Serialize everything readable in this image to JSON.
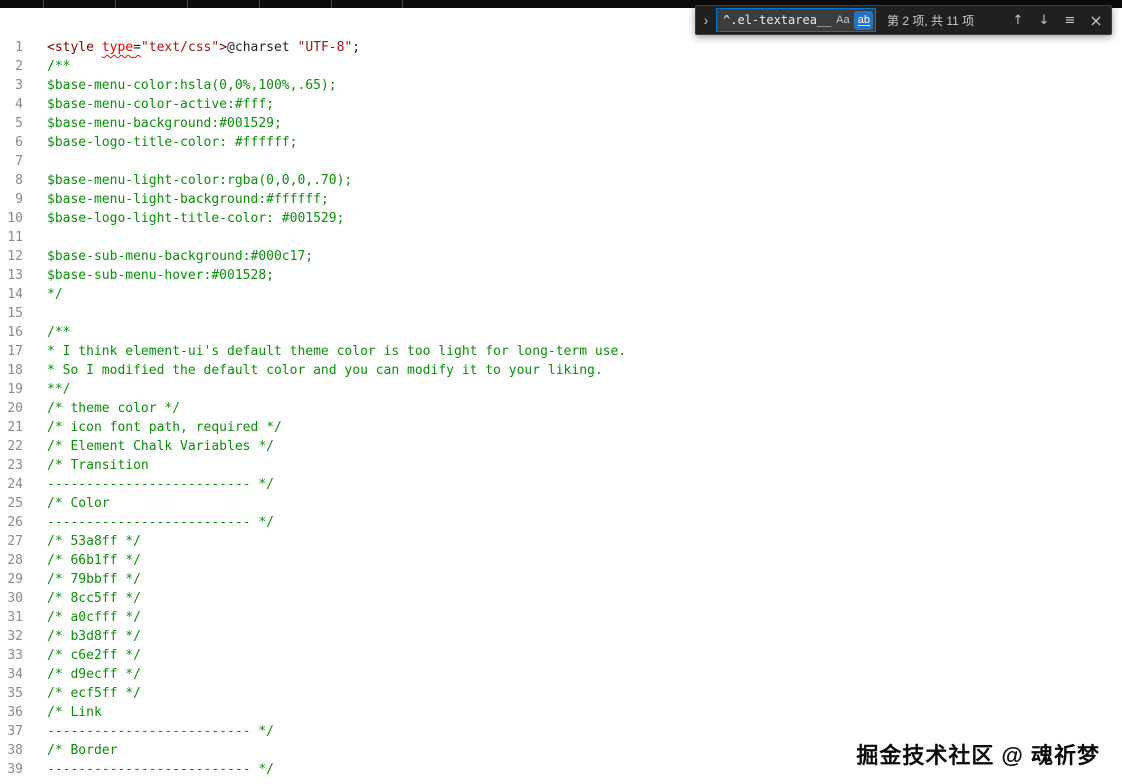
{
  "find_widget": {
    "chevron_icon": "›",
    "query_before_cursor": "^.el-",
    "query_after_cursor": "textarea__",
    "match_case_label": "Aa",
    "whole_word_label": "ab",
    "regex_label": ".*",
    "results_text": "第 2 项, 共 11 项",
    "prev_icon": "↑",
    "next_icon": "↓",
    "selection_icon": "≡",
    "close_icon": "×",
    "accent_color": "#0078d4",
    "toggle_active_bg": "#2473bf"
  },
  "editor": {
    "lines": [
      {
        "kind": "code",
        "tokens": [
          {
            "text": "<style ",
            "class": "tag"
          },
          {
            "text": "type",
            "class": "attr sq"
          },
          {
            "text": "=",
            "class": "plain sq"
          },
          {
            "text": "\"text/css\"",
            "class": "string"
          },
          {
            "text": ">",
            "class": "tag"
          },
          {
            "text": "@charset ",
            "class": "plain"
          },
          {
            "text": "\"UTF-8\"",
            "class": "string"
          },
          {
            "text": ";",
            "class": "plain"
          }
        ]
      },
      {
        "kind": "comment",
        "text": "/**"
      },
      {
        "kind": "comment",
        "text": "$base-menu-color:hsla(0,0%,100%,.65);"
      },
      {
        "kind": "comment",
        "text": "$base-menu-color-active:#fff;"
      },
      {
        "kind": "comment",
        "text": "$base-menu-background:#001529;"
      },
      {
        "kind": "comment",
        "text": "$base-logo-title-color: #ffffff;"
      },
      {
        "kind": "blank",
        "text": ""
      },
      {
        "kind": "comment",
        "text": "$base-menu-light-color:rgba(0,0,0,.70);"
      },
      {
        "kind": "comment",
        "text": "$base-menu-light-background:#ffffff;"
      },
      {
        "kind": "comment",
        "text": "$base-logo-light-title-color: #001529;"
      },
      {
        "kind": "blank",
        "text": ""
      },
      {
        "kind": "comment",
        "text": "$base-sub-menu-background:#000c17;"
      },
      {
        "kind": "comment",
        "text": "$base-sub-menu-hover:#001528;"
      },
      {
        "kind": "comment",
        "text": "*/"
      },
      {
        "kind": "blank",
        "text": ""
      },
      {
        "kind": "comment",
        "text": "/**"
      },
      {
        "kind": "comment",
        "text": "* I think element-ui's default theme color is too light for long-term use."
      },
      {
        "kind": "comment",
        "text": "* So I modified the default color and you can modify it to your liking."
      },
      {
        "kind": "comment",
        "text": "**/"
      },
      {
        "kind": "comment",
        "text": "/* theme color */"
      },
      {
        "kind": "comment",
        "text": "/* icon font path, required */"
      },
      {
        "kind": "comment",
        "text": "/* Element Chalk Variables */"
      },
      {
        "kind": "comment",
        "text": "/* Transition"
      },
      {
        "kind": "comment",
        "text": "-------------------------- */"
      },
      {
        "kind": "comment",
        "text": "/* Color"
      },
      {
        "kind": "comment",
        "text": "-------------------------- */"
      },
      {
        "kind": "comment",
        "text": "/* 53a8ff */"
      },
      {
        "kind": "comment",
        "text": "/* 66b1ff */"
      },
      {
        "kind": "comment",
        "text": "/* 79bbff */"
      },
      {
        "kind": "comment",
        "text": "/* 8cc5ff */"
      },
      {
        "kind": "comment",
        "text": "/* a0cfff */"
      },
      {
        "kind": "comment",
        "text": "/* b3d8ff */"
      },
      {
        "kind": "comment",
        "text": "/* c6e2ff */"
      },
      {
        "kind": "comment",
        "text": "/* d9ecff */"
      },
      {
        "kind": "comment",
        "text": "/* ecf5ff */"
      },
      {
        "kind": "comment",
        "text": "/* Link"
      },
      {
        "kind": "comment",
        "text": "-------------------------- */"
      },
      {
        "kind": "comment",
        "text": "/* Border"
      },
      {
        "kind": "comment",
        "text": "-------------------------- */"
      }
    ]
  },
  "watermark": {
    "text": "掘金技术社区 @ 魂祈梦"
  },
  "palette": {
    "page_bg": "#ffffff",
    "top_bar_bg": "#0c0c0c",
    "find_widget_bg": "#202020",
    "find_input_bg": "#3c3c3c",
    "comment_green": "#0a8f0a",
    "gutter_gray": "#8a8a8a",
    "string_red": "#a31515",
    "error_squiggle_red": "#e51400"
  }
}
